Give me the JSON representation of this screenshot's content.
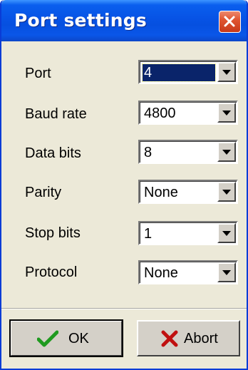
{
  "window": {
    "title": "Port settings",
    "close_icon": "close-icon"
  },
  "fields": [
    {
      "label": "Port",
      "value": "4",
      "selected": true
    },
    {
      "label": "Baud rate",
      "value": "4800"
    },
    {
      "label": "Data bits",
      "value": "8"
    },
    {
      "label": "Parity",
      "value": "None"
    },
    {
      "label": "Stop bits",
      "value": "1"
    },
    {
      "label": "Protocol",
      "value": "None"
    }
  ],
  "buttons": {
    "ok_label": "OK",
    "ok_icon": "checkmark-icon",
    "abort_label": "Abort",
    "abort_icon": "x-mark-icon"
  },
  "colors": {
    "titlebar": "#0753e5",
    "dialog_background": "#ece9d8",
    "selection": "#0a246a",
    "ok_check": "#1f9a1f",
    "abort_x": "#c01010"
  }
}
